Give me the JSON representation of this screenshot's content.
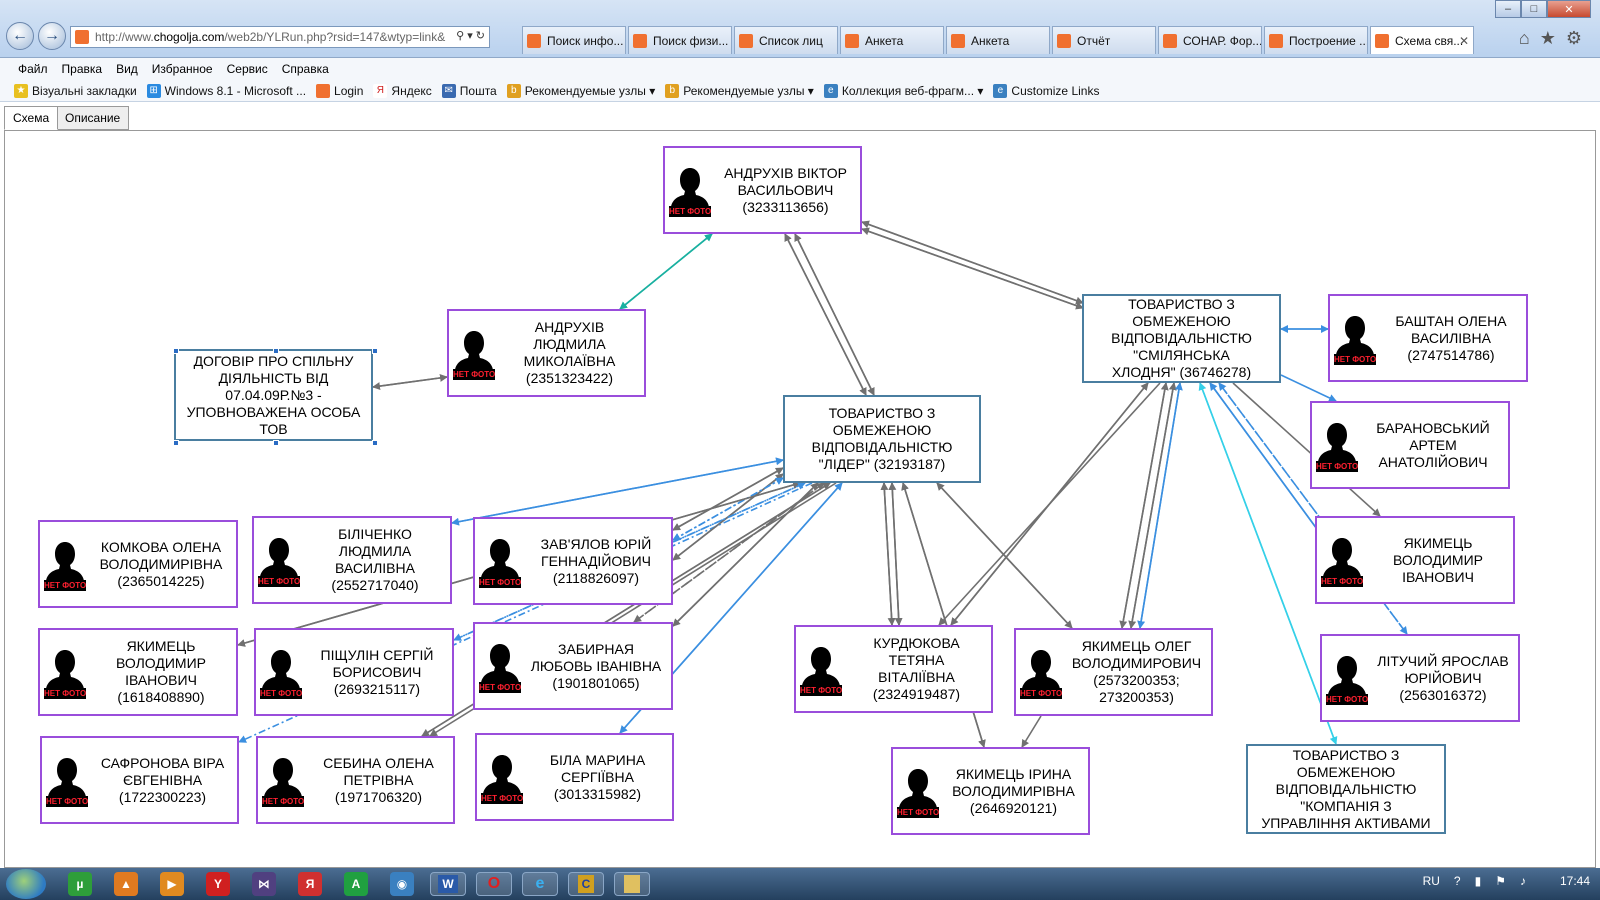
{
  "browser": {
    "url_prefix": "http://www.",
    "url_host": "chogolja.com",
    "url_path": "/web2b/YLRun.php?rsid=147&wtyp=link&",
    "tabs": [
      {
        "label": "Поиск инфо..."
      },
      {
        "label": "Поиск физи..."
      },
      {
        "label": "Список лиц"
      },
      {
        "label": "Анкета"
      },
      {
        "label": "Анкета"
      },
      {
        "label": "Отчёт"
      },
      {
        "label": "СОНАР. Фор..."
      },
      {
        "label": "Построение ..."
      },
      {
        "label": "Схема свя..."
      }
    ],
    "menu": [
      "Файл",
      "Правка",
      "Вид",
      "Избранное",
      "Сервис",
      "Справка"
    ],
    "favorites": [
      {
        "label": "Візуальні закладки"
      },
      {
        "label": "Windows 8.1 - Microsoft ..."
      },
      {
        "label": "Login"
      },
      {
        "label": "Яндекс"
      },
      {
        "label": "Пошта"
      },
      {
        "label": "Рекомендуемые узлы ▾"
      },
      {
        "label": "Рекомендуемые узлы ▾"
      },
      {
        "label": "Коллекция веб-фрагм... ▾"
      },
      {
        "label": "Customize Links"
      }
    ]
  },
  "page_tabs": [
    "Схема",
    "Описание"
  ],
  "no_photo_label": "НЕТ ФОТО",
  "nodes": {
    "andrukhiv_viktor": {
      "lines": [
        "АНДРУХІВ ВІКТОР",
        "ВАСИЛЬОВИЧ",
        "(3233113656)"
      ]
    },
    "andrukhiv_liudmyla": {
      "lines": [
        "АНДРУХІВ",
        "ЛЮДМИЛА",
        "МИКОЛАЇВНА",
        "(2351323422)"
      ]
    },
    "dogovir": {
      "lines": [
        "ДОГОВІР ПРО СПІЛЬНУ",
        "ДІЯЛЬНІСТЬ ВІД",
        "07.04.09Р.№3 -",
        "УПОВНОВАЖЕНА ОСОБА",
        "ТОВ"
      ]
    },
    "lider": {
      "lines": [
        "ТОВАРИСТВО З",
        "ОБМЕЖЕНОЮ",
        "ВІДПОВІДАЛЬНІСТЮ",
        "\"ЛІДЕР\" (32193187)"
      ]
    },
    "smila": {
      "lines": [
        "ТОВАРИСТВО З",
        "ОБМЕЖЕНОЮ",
        "ВІДПОВІДАЛЬНІСТЮ",
        "\"СМІЛЯНСЬКА",
        "ХЛОДНЯ\" (36746278)"
      ]
    },
    "bashtan": {
      "lines": [
        "БАШТАН ОЛЕНА",
        "ВАСИЛІВНА",
        "(2747514786)"
      ]
    },
    "baranovskyi": {
      "lines": [
        "БАРАНОВСЬКИЙ",
        "АРТЕМ",
        "АНАТОЛІЙОВИЧ"
      ]
    },
    "yakymets_v_right": {
      "lines": [
        "ЯКИМЕЦЬ",
        "ВОЛОДИМИР",
        "ІВАНОВИЧ"
      ]
    },
    "lituchyi": {
      "lines": [
        "ЛІТУЧИЙ ЯРОСЛАВ",
        "ЮРІЙОВИЧ",
        "(2563016372)"
      ]
    },
    "kompaniia": {
      "lines": [
        "ТОВАРИСТВО З",
        "ОБМЕЖЕНОЮ",
        "ВІДПОВІДАЛЬНІСТЮ",
        "\"КОМПАНІЯ З",
        "УПРАВЛІННЯ АКТИВАМИ"
      ]
    },
    "komkova": {
      "lines": [
        "КОМКОВА ОЛЕНА",
        "ВОЛОДИМИРІВНА",
        "(2365014225)"
      ]
    },
    "bilichenko": {
      "lines": [
        "БІЛІЧЕНКО",
        "ЛЮДМИЛА",
        "ВАСИЛІВНА",
        "(2552717040)"
      ]
    },
    "zavialov": {
      "lines": [
        "ЗАВ'ЯЛОВ ЮРІЙ",
        "ГЕННАДІЙОВИЧ",
        "(2118826097)"
      ]
    },
    "yakymets_v_left": {
      "lines": [
        "ЯКИМЕЦЬ",
        "ВОЛОДИМИР",
        "ІВАНОВИЧ",
        "(1618408890)"
      ]
    },
    "pishchulin": {
      "lines": [
        "ПІЩУЛІН СЕРГІЙ",
        "БОРИСОВИЧ",
        "(2693215117)"
      ]
    },
    "zabyrna": {
      "lines": [
        "ЗАБИРНАЯ",
        "ЛЮБОВЬ ІВАНІВНА",
        "(1901801065)"
      ]
    },
    "safronova": {
      "lines": [
        "САФРОНОВА ВІРА",
        "ЄВГЕНІВНА",
        "(1722300223)"
      ]
    },
    "sebyna": {
      "lines": [
        "СЕБИНА ОЛЕНА",
        "ПЕТРІВНА",
        "(1971706320)"
      ]
    },
    "bila": {
      "lines": [
        "БІЛА МАРИНА",
        "СЕРГІЇВНА",
        "(3013315982)"
      ]
    },
    "kurdiukova": {
      "lines": [
        "КУРДЮКОВА",
        "ТЕТЯНА",
        "ВІТАЛІЇВНА",
        "(2324919487)"
      ]
    },
    "yakymets_oleh": {
      "lines": [
        "ЯКИМЕЦЬ ОЛЕГ",
        "ВОЛОДИМИРОВИЧ",
        "(2573200353;",
        "273200353)"
      ]
    },
    "yakymets_iryna": {
      "lines": [
        "ЯКИМЕЦЬ ІРИНА",
        "ВОЛОДИМИРІВНА",
        "(2646920121)"
      ]
    }
  },
  "colors": {
    "person_border": "#9a4ddb",
    "org_border": "#4a7ea0",
    "link_gray": "#707070",
    "link_blue": "#3b8fe0",
    "link_teal": "#19b0a0",
    "link_cyan": "#35d0e8"
  },
  "taskbar": {
    "lang": "RU",
    "time": "17:44"
  }
}
